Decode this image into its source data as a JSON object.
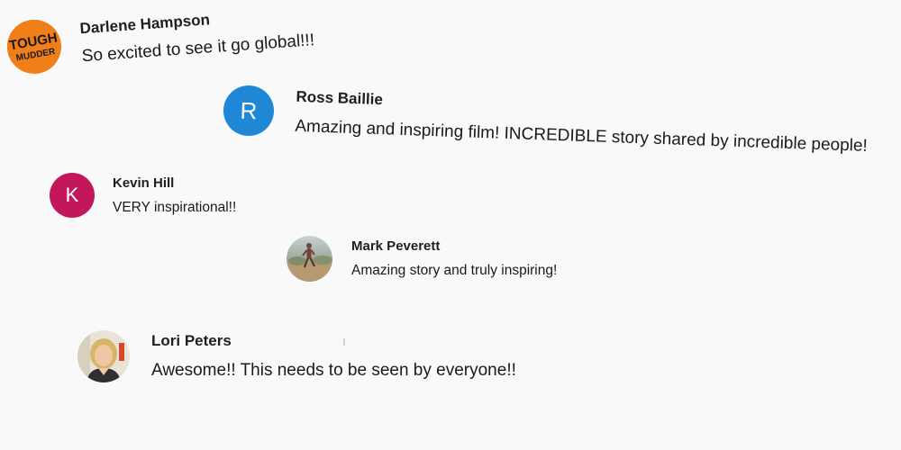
{
  "comments": [
    {
      "author": "Darlene Hampson",
      "text": "So excited to see it go global!!!",
      "avatar": {
        "type": "logo",
        "logo_line1": "TOUGH",
        "logo_line2": "MUDDER",
        "color": "#f07f1a",
        "text_color": "#1a1a1a"
      }
    },
    {
      "author": "Ross Baillie",
      "text": "Amazing and inspiring film! INCREDIBLE story shared by incredible people!",
      "avatar": {
        "type": "letter",
        "letter": "R",
        "color": "#1e88d6"
      }
    },
    {
      "author": "Kevin Hill",
      "text": "VERY inspirational!!",
      "avatar": {
        "type": "letter",
        "letter": "K",
        "color": "#c2185b"
      }
    },
    {
      "author": "Mark Peverett",
      "text": "Amazing story and truly inspiring!",
      "avatar": {
        "type": "photo",
        "icon": "runner-photo-icon"
      }
    },
    {
      "author": "Lori Peters",
      "text": "Awesome!!  This needs to be seen by everyone!!",
      "avatar": {
        "type": "photo",
        "icon": "person-photo-icon"
      }
    }
  ]
}
